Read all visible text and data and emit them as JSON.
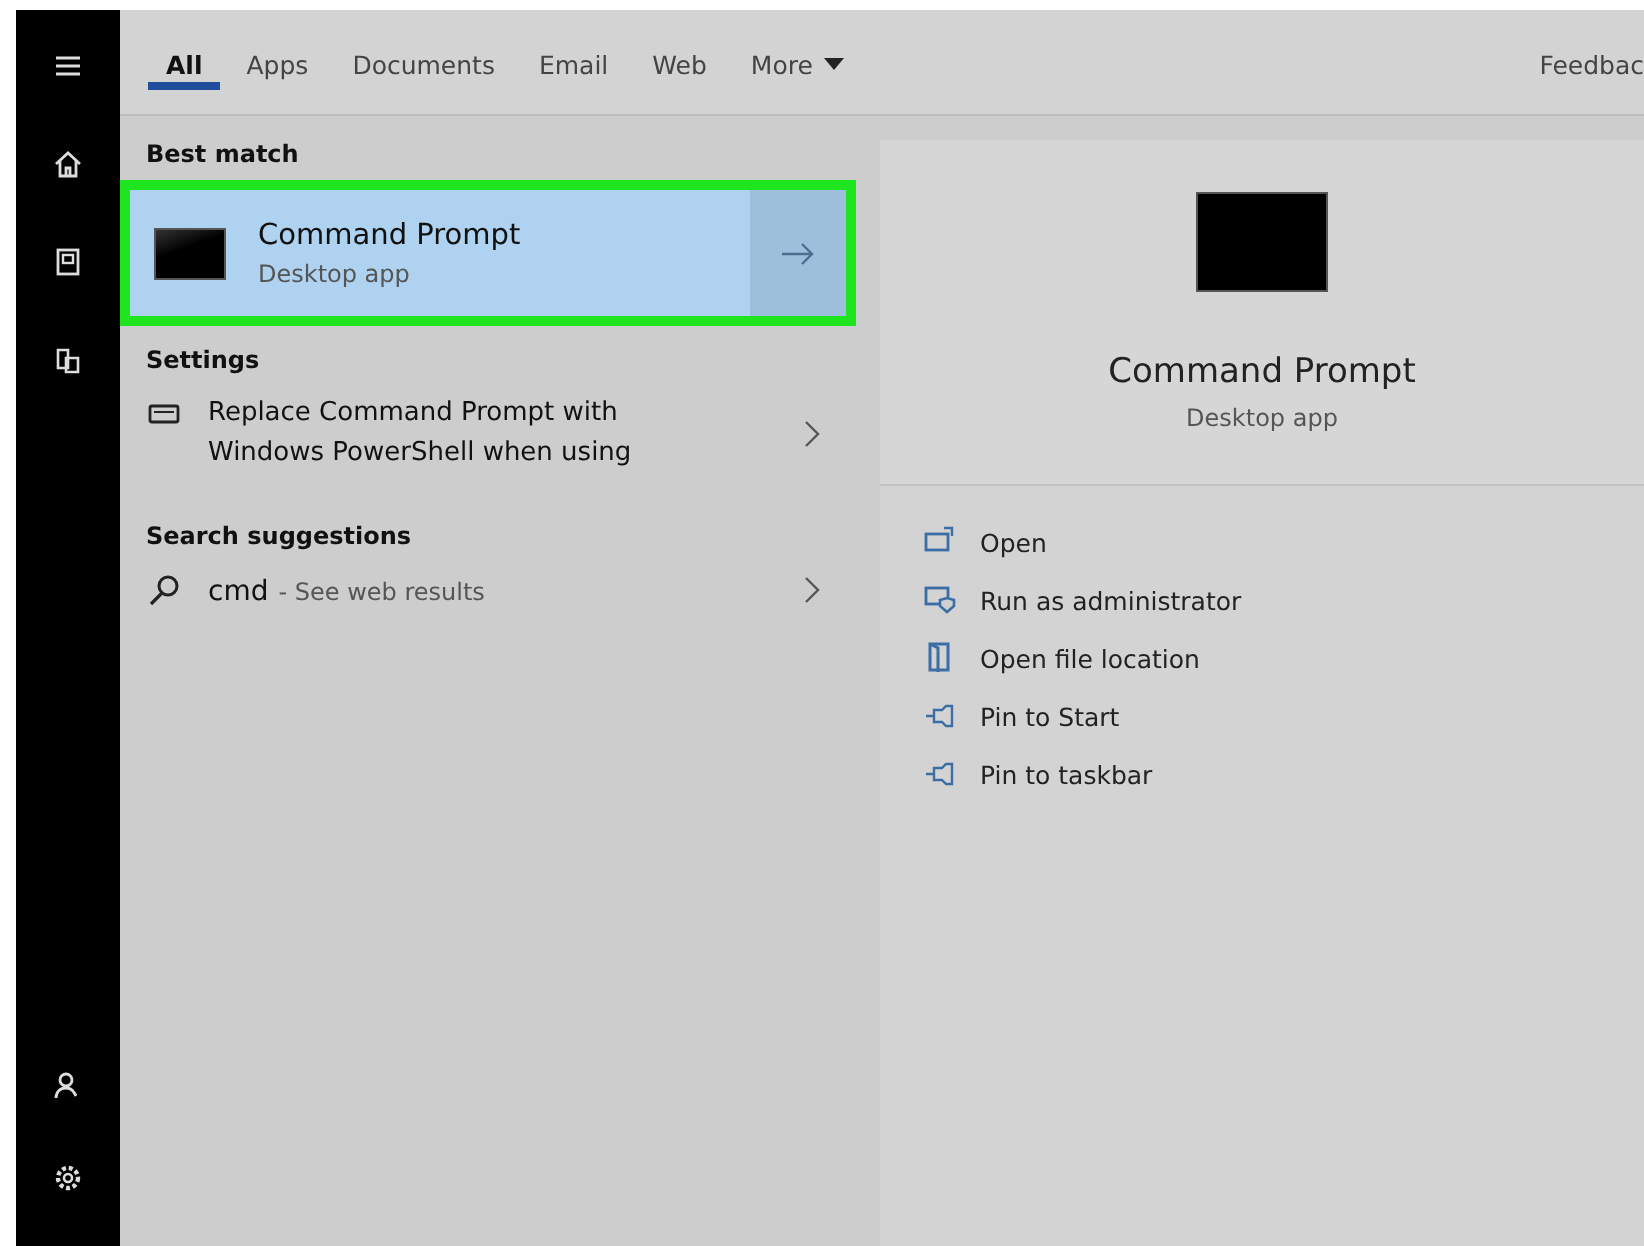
{
  "tabs": [
    {
      "label": "All",
      "selected": true
    },
    {
      "label": "Apps",
      "selected": false
    },
    {
      "label": "Documents",
      "selected": false
    },
    {
      "label": "Email",
      "selected": false
    },
    {
      "label": "Web",
      "selected": false
    },
    {
      "label": "More",
      "selected": false,
      "dropdown": true
    }
  ],
  "feedback": "Feedbac",
  "sections": [
    {
      "heading": "Best match",
      "items": [
        {
          "kind": "app",
          "title": "Command Prompt",
          "subtitle": "Desktop app",
          "selected": true,
          "outlined": true
        }
      ]
    },
    {
      "heading": "Settings",
      "items": [
        {
          "kind": "setting",
          "title": "Replace Command Prompt with Windows PowerShell when using",
          "selected": false,
          "outlined": false
        }
      ]
    },
    {
      "heading": "Search suggestions",
      "items": [
        {
          "kind": "web",
          "title": "cmd",
          "subtitle": "- See web results",
          "selected": false,
          "outlined": false
        }
      ]
    }
  ],
  "preview": {
    "title": "Command Prompt",
    "subtitle": "Desktop app",
    "actions": [
      {
        "kind": "open",
        "label": "Open"
      },
      {
        "kind": "admin",
        "label": "Run as administrator"
      },
      {
        "kind": "folder",
        "label": "Open file location"
      },
      {
        "kind": "pin",
        "label": "Pin to Start"
      },
      {
        "kind": "pin",
        "label": "Pin to taskbar"
      }
    ]
  }
}
